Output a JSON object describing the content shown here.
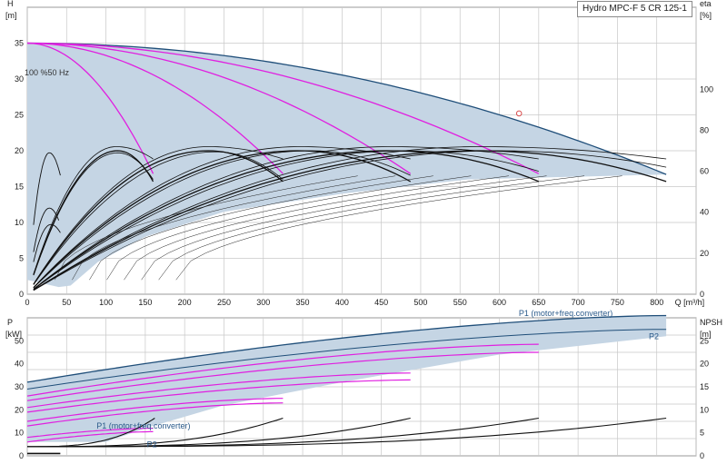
{
  "chart_data": [
    {
      "type": "line",
      "title": "Hydro MPC-F 5 CR 125-1",
      "x_label": "Q [m³/h]",
      "y_label_left": [
        "H",
        "[m]"
      ],
      "y_label_right": [
        "eta",
        "[%]"
      ],
      "x_range": [
        0,
        850
      ],
      "x_ticks": [
        0,
        50,
        100,
        150,
        200,
        250,
        300,
        350,
        400,
        450,
        500,
        550,
        600,
        650,
        700,
        750,
        800
      ],
      "y_left_range": [
        0,
        40
      ],
      "y_left_ticks": [
        0,
        5,
        10,
        15,
        20,
        25,
        30,
        35
      ],
      "y_right_range": [
        0,
        140
      ],
      "y_right_ticks": [
        0,
        20,
        40,
        60,
        80,
        100
      ],
      "grid": true,
      "speed_label": "100 %50 Hz",
      "duty_point": {
        "x": 625,
        "y": 25.2
      },
      "qh_envelope": {
        "h0": 35,
        "q_max": 812,
        "h_end": 16.7
      },
      "qh_magenta": [
        {
          "q_max": 160,
          "h_end": 16.8
        },
        {
          "q_max": 325,
          "h_end": 16.8
        },
        {
          "q_max": 487,
          "h_end": 16.8
        },
        {
          "q_max": 650,
          "h_end": 16.8
        }
      ],
      "eta_main": [
        {
          "q_max": 160,
          "peak_q": 115,
          "peak": 70,
          "end": 55
        },
        {
          "q_max": 325,
          "peak_q": 230,
          "peak": 70,
          "end": 55
        },
        {
          "q_max": 487,
          "peak_q": 345,
          "peak": 70,
          "end": 55
        },
        {
          "q_max": 650,
          "peak_q": 460,
          "peak": 70,
          "end": 55
        },
        {
          "q_max": 812,
          "peak_q": 575,
          "peak": 70,
          "end": 55
        }
      ],
      "eta_envelope": [
        {
          "q_max": 160,
          "peak_q": 113,
          "peak": 72,
          "end": 66
        },
        {
          "q_max": 325,
          "peak_q": 230,
          "peak": 72,
          "end": 66
        },
        {
          "q_max": 487,
          "peak_q": 345,
          "peak": 72,
          "end": 66
        },
        {
          "q_max": 650,
          "peak_q": 460,
          "peak": 72,
          "end": 66
        },
        {
          "q_max": 812,
          "peak_q": 575,
          "peak": 72,
          "end": 66
        }
      ],
      "eta_envelope_high": [
        {
          "q_max": 160,
          "peak_q": 115,
          "peak": 69,
          "end": 56
        },
        {
          "q_max": 325,
          "peak_q": 240,
          "peak": 69.5,
          "end": 56
        },
        {
          "q_max": 487,
          "peak_q": 360,
          "peak": 70,
          "end": 58
        },
        {
          "q_max": 650,
          "peak_q": 480,
          "peak": 70,
          "end": 60
        },
        {
          "q_max": 812,
          "peak_q": 600,
          "peak": 70,
          "end": 62
        }
      ],
      "eta_small": [
        {
          "q_max": 42,
          "peak_q": 28,
          "peak": 69,
          "end": 58
        },
        {
          "q_max": 40,
          "peak_q": 28,
          "peak": 42,
          "end": 36
        },
        {
          "q_max": 42,
          "peak_q": 30,
          "peak": 34,
          "end": 30
        }
      ]
    },
    {
      "type": "line",
      "x_range": [
        0,
        850
      ],
      "y_label_left": [
        "P",
        "[kW]"
      ],
      "y_label_right": [
        "NPSH",
        "[m]"
      ],
      "y_left_range": [
        0,
        60
      ],
      "y_left_ticks": [
        0,
        10,
        20,
        30,
        40,
        50
      ],
      "y_right_range": [
        0,
        30
      ],
      "y_right_ticks": [
        0,
        5,
        10,
        15,
        20,
        25
      ],
      "grid": true,
      "labels": {
        "p1_top": "P1 (motor+freq.converter)",
        "p2_top": "P2",
        "p1_low": "P1 (motor+freq.converter)",
        "p2_low": "P2"
      },
      "p1_main": {
        "q_max": 812,
        "start": 32,
        "end": 61
      },
      "p2_main": {
        "q_max": 812,
        "start": 29,
        "end": 55
      },
      "p_magenta": [
        {
          "q_max": 650,
          "start": 26,
          "end": 48.5
        },
        {
          "q_max": 650,
          "start": 24,
          "end": 45
        },
        {
          "q_max": 487,
          "start": 21,
          "end": 36
        },
        {
          "q_max": 487,
          "start": 19,
          "end": 33
        },
        {
          "q_max": 325,
          "start": 15,
          "end": 25
        },
        {
          "q_max": 325,
          "start": 13,
          "end": 23
        },
        {
          "q_max": 160,
          "start": 8,
          "end": 12
        },
        {
          "q_max": 160,
          "start": 6,
          "end": 10.5
        }
      ],
      "npsh_curves": [
        {
          "q_max": 162,
          "end": 8.2
        },
        {
          "q_max": 325,
          "end": 8.2
        },
        {
          "q_max": 487,
          "end": 8.2
        },
        {
          "q_max": 650,
          "end": 8.2
        },
        {
          "q_max": 812,
          "end": 8.2
        }
      ]
    }
  ]
}
